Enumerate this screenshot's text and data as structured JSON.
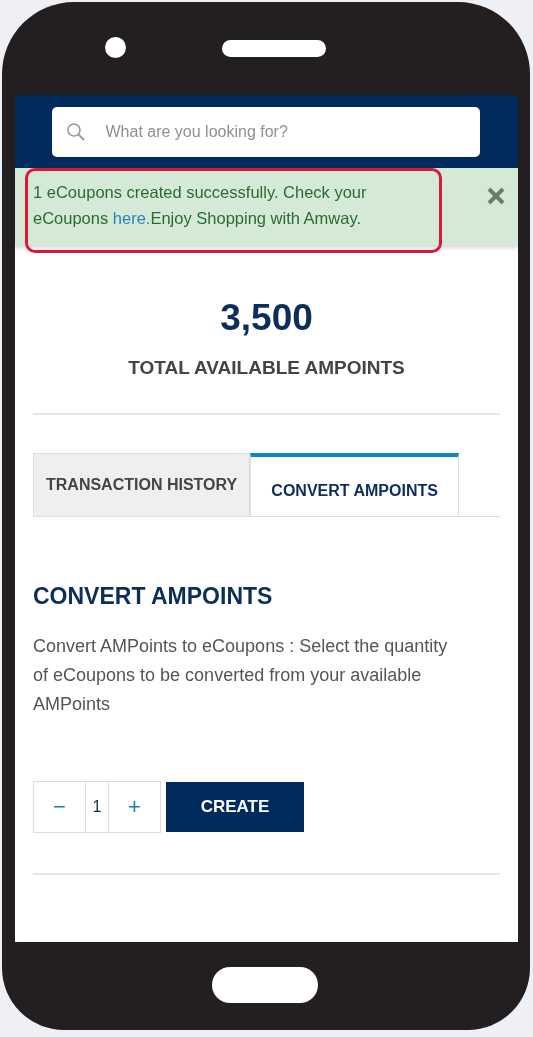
{
  "search": {
    "placeholder": "What are you looking for?"
  },
  "alert": {
    "text_before": "1 eCoupons created successfully. Check your eCoupons ",
    "link": "here.",
    "text_after": "Enjoy Shopping with Amway.",
    "highlighted": true
  },
  "points": {
    "amount": "3,500",
    "label": "TOTAL AVAILABLE AMPOINTS"
  },
  "tabs": [
    {
      "label": "TRANSACTION HISTORY",
      "selected": false
    },
    {
      "label": "CONVERT AMPOINTS",
      "selected": true
    }
  ],
  "convert": {
    "heading": "CONVERT AMPOINTS",
    "description": "Convert AMPoints to eCoupons : Select the quantity of eCoupons to be converted from your available AMPoints",
    "decrement": "−",
    "quantity": "1",
    "increment": "+",
    "button": "CREATE"
  }
}
